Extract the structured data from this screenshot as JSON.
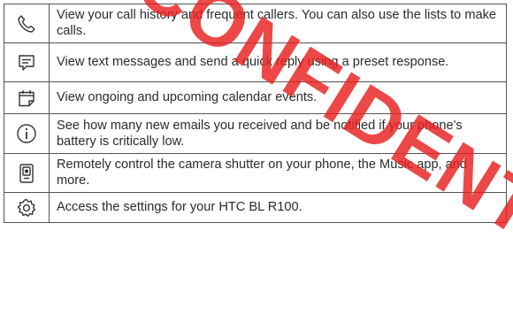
{
  "rows": [
    {
      "icon": "phone-icon",
      "text": "View your call history and frequent callers. You can also use the lists to make calls."
    },
    {
      "icon": "message-icon",
      "text": "View text messages and send a quick reply using a preset response."
    },
    {
      "icon": "calendar-icon",
      "text": "View ongoing and upcoming calendar events."
    },
    {
      "icon": "info-icon",
      "text": "See how many new emails you received and be notified if your phone's battery is critically low."
    },
    {
      "icon": "remote-control-icon",
      "text": "Remotely control the camera shutter on your phone, the Music app, and more."
    },
    {
      "icon": "settings-icon",
      "text": "Access the settings for your HTC BL R100."
    }
  ],
  "watermark": "CONFIDENTIAL",
  "colors": {
    "border": "#555555",
    "text": "#2b2b2b",
    "watermark": "#e82020"
  }
}
